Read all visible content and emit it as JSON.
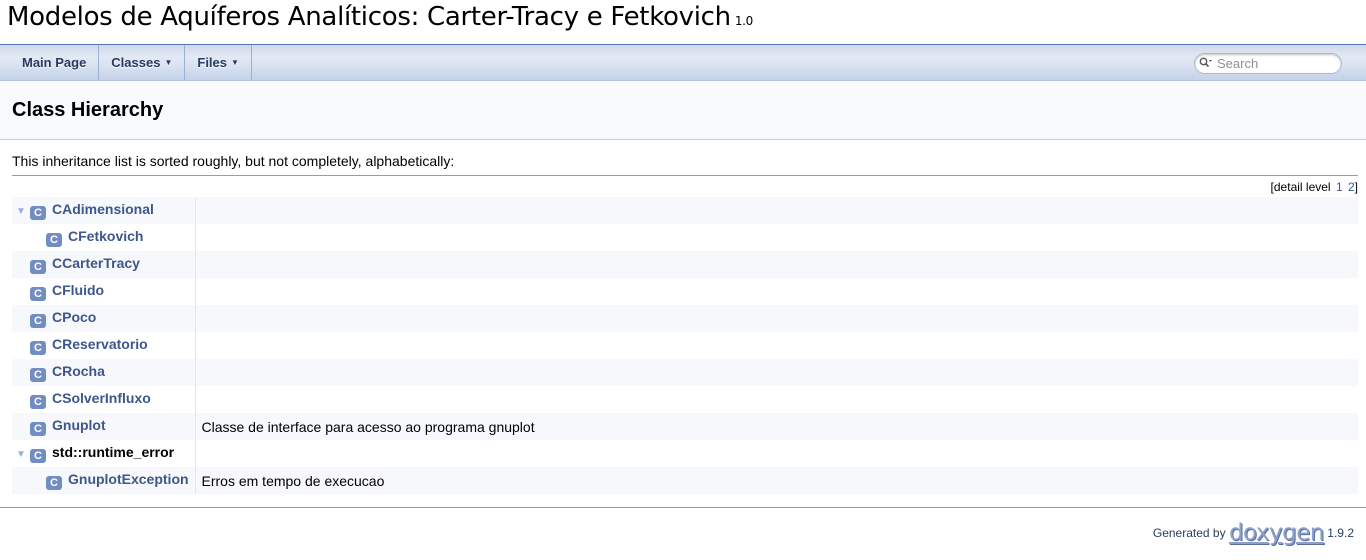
{
  "project": {
    "name": "Modelos de Aquíferos Analíticos: Carter-Tracy e Fetkovich",
    "version": "1.0"
  },
  "nav": {
    "items": [
      {
        "label": "Main Page"
      },
      {
        "label": "Classes"
      },
      {
        "label": "Files"
      }
    ],
    "search_placeholder": "Search"
  },
  "header": {
    "title": "Class Hierarchy"
  },
  "intro": "This inheritance list is sorted roughly, but not completely, alphabetically:",
  "levels": {
    "prefix": "[detail level",
    "one": "1",
    "two": "2",
    "suffix": "]"
  },
  "classes": [
    {
      "name": "CAdimensional",
      "desc": "",
      "icon": "C"
    },
    {
      "name": "CFetkovich",
      "desc": "",
      "icon": "C"
    },
    {
      "name": "CCarterTracy",
      "desc": "",
      "icon": "C"
    },
    {
      "name": "CFluido",
      "desc": "",
      "icon": "C"
    },
    {
      "name": "CPoco",
      "desc": "",
      "icon": "C"
    },
    {
      "name": "CReservatorio",
      "desc": "",
      "icon": "C"
    },
    {
      "name": "CRocha",
      "desc": "",
      "icon": "C"
    },
    {
      "name": "CSolverInfluxo",
      "desc": "",
      "icon": "C"
    },
    {
      "name": "Gnuplot",
      "desc": "Classe de interface para acesso ao programa gnuplot",
      "icon": "C"
    },
    {
      "name": "std::runtime_error",
      "desc": "",
      "icon": "C"
    },
    {
      "name": "GnuplotException",
      "desc": "Erros em tempo de execucao",
      "icon": "C"
    }
  ],
  "footer": {
    "generated_by": "Generated by",
    "tool": "doxygen",
    "tool_version": "1.9.2"
  },
  "colors": {
    "link": "#3d578c",
    "icon_bg": "#728dc1",
    "separator": "#879ecb"
  }
}
